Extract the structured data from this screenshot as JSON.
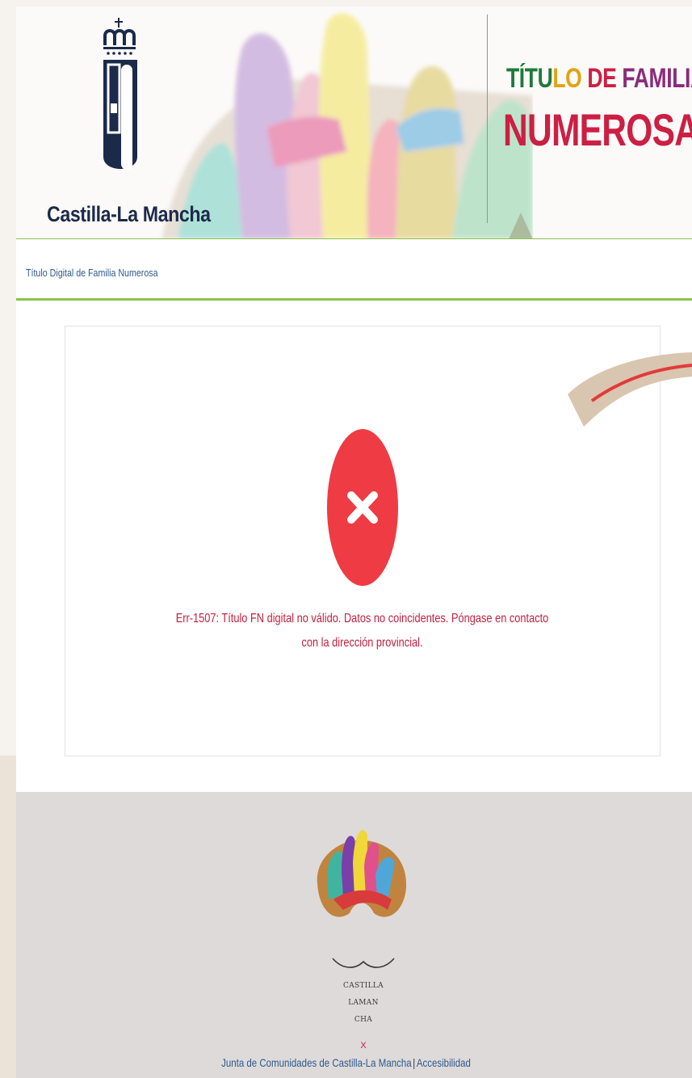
{
  "header": {
    "logo_text": "Castilla-La Mancha",
    "title_line1_parts": [
      "TÍTU",
      "LO",
      " DE ",
      "FAMILIA"
    ],
    "title_line2": "NUMEROSA"
  },
  "breadcrumb": {
    "label": "Título Digital de Familia Numerosa"
  },
  "error": {
    "line1": "Err-1507: Título FN digital no válido. Datos no coincidentes. Póngase en contacto",
    "line2": "con la dirección provincial."
  },
  "footer": {
    "brand_lines": [
      "CASTILLA",
      "LAMAN",
      "CHA"
    ],
    "brand_mark": "X",
    "link_junta": "Junta de Comunidades de Castilla-La Mancha",
    "separator": "|",
    "link_accesibilidad": "Accesibilidad"
  },
  "colors": {
    "accent_green": "#8cc24a",
    "error_red": "#c2203e",
    "error_icon_red": "#ee3b44",
    "link_blue": "#2d5a8e"
  }
}
